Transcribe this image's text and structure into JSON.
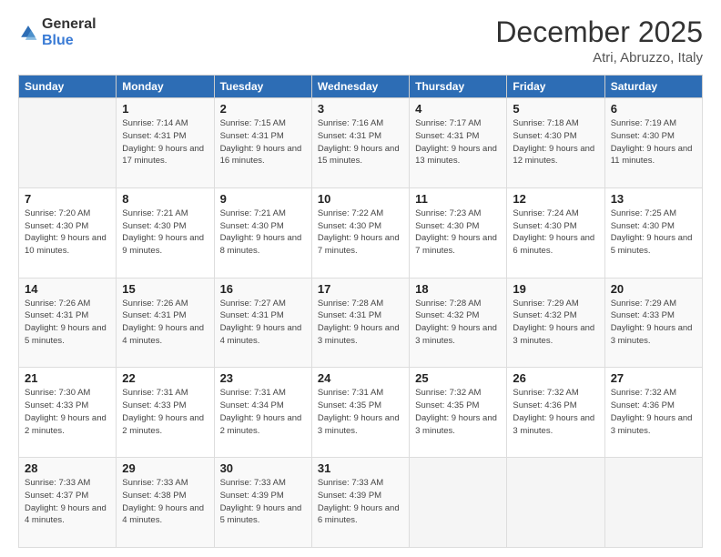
{
  "logo": {
    "general": "General",
    "blue": "Blue"
  },
  "header": {
    "month": "December 2025",
    "location": "Atri, Abruzzo, Italy"
  },
  "weekdays": [
    "Sunday",
    "Monday",
    "Tuesday",
    "Wednesday",
    "Thursday",
    "Friday",
    "Saturday"
  ],
  "weeks": [
    [
      {
        "day": "",
        "sunrise": "",
        "sunset": "",
        "daylight": ""
      },
      {
        "day": "1",
        "sunrise": "Sunrise: 7:14 AM",
        "sunset": "Sunset: 4:31 PM",
        "daylight": "Daylight: 9 hours and 17 minutes."
      },
      {
        "day": "2",
        "sunrise": "Sunrise: 7:15 AM",
        "sunset": "Sunset: 4:31 PM",
        "daylight": "Daylight: 9 hours and 16 minutes."
      },
      {
        "day": "3",
        "sunrise": "Sunrise: 7:16 AM",
        "sunset": "Sunset: 4:31 PM",
        "daylight": "Daylight: 9 hours and 15 minutes."
      },
      {
        "day": "4",
        "sunrise": "Sunrise: 7:17 AM",
        "sunset": "Sunset: 4:31 PM",
        "daylight": "Daylight: 9 hours and 13 minutes."
      },
      {
        "day": "5",
        "sunrise": "Sunrise: 7:18 AM",
        "sunset": "Sunset: 4:30 PM",
        "daylight": "Daylight: 9 hours and 12 minutes."
      },
      {
        "day": "6",
        "sunrise": "Sunrise: 7:19 AM",
        "sunset": "Sunset: 4:30 PM",
        "daylight": "Daylight: 9 hours and 11 minutes."
      }
    ],
    [
      {
        "day": "7",
        "sunrise": "Sunrise: 7:20 AM",
        "sunset": "Sunset: 4:30 PM",
        "daylight": "Daylight: 9 hours and 10 minutes."
      },
      {
        "day": "8",
        "sunrise": "Sunrise: 7:21 AM",
        "sunset": "Sunset: 4:30 PM",
        "daylight": "Daylight: 9 hours and 9 minutes."
      },
      {
        "day": "9",
        "sunrise": "Sunrise: 7:21 AM",
        "sunset": "Sunset: 4:30 PM",
        "daylight": "Daylight: 9 hours and 8 minutes."
      },
      {
        "day": "10",
        "sunrise": "Sunrise: 7:22 AM",
        "sunset": "Sunset: 4:30 PM",
        "daylight": "Daylight: 9 hours and 7 minutes."
      },
      {
        "day": "11",
        "sunrise": "Sunrise: 7:23 AM",
        "sunset": "Sunset: 4:30 PM",
        "daylight": "Daylight: 9 hours and 7 minutes."
      },
      {
        "day": "12",
        "sunrise": "Sunrise: 7:24 AM",
        "sunset": "Sunset: 4:30 PM",
        "daylight": "Daylight: 9 hours and 6 minutes."
      },
      {
        "day": "13",
        "sunrise": "Sunrise: 7:25 AM",
        "sunset": "Sunset: 4:30 PM",
        "daylight": "Daylight: 9 hours and 5 minutes."
      }
    ],
    [
      {
        "day": "14",
        "sunrise": "Sunrise: 7:26 AM",
        "sunset": "Sunset: 4:31 PM",
        "daylight": "Daylight: 9 hours and 5 minutes."
      },
      {
        "day": "15",
        "sunrise": "Sunrise: 7:26 AM",
        "sunset": "Sunset: 4:31 PM",
        "daylight": "Daylight: 9 hours and 4 minutes."
      },
      {
        "day": "16",
        "sunrise": "Sunrise: 7:27 AM",
        "sunset": "Sunset: 4:31 PM",
        "daylight": "Daylight: 9 hours and 4 minutes."
      },
      {
        "day": "17",
        "sunrise": "Sunrise: 7:28 AM",
        "sunset": "Sunset: 4:31 PM",
        "daylight": "Daylight: 9 hours and 3 minutes."
      },
      {
        "day": "18",
        "sunrise": "Sunrise: 7:28 AM",
        "sunset": "Sunset: 4:32 PM",
        "daylight": "Daylight: 9 hours and 3 minutes."
      },
      {
        "day": "19",
        "sunrise": "Sunrise: 7:29 AM",
        "sunset": "Sunset: 4:32 PM",
        "daylight": "Daylight: 9 hours and 3 minutes."
      },
      {
        "day": "20",
        "sunrise": "Sunrise: 7:29 AM",
        "sunset": "Sunset: 4:33 PM",
        "daylight": "Daylight: 9 hours and 3 minutes."
      }
    ],
    [
      {
        "day": "21",
        "sunrise": "Sunrise: 7:30 AM",
        "sunset": "Sunset: 4:33 PM",
        "daylight": "Daylight: 9 hours and 2 minutes."
      },
      {
        "day": "22",
        "sunrise": "Sunrise: 7:31 AM",
        "sunset": "Sunset: 4:33 PM",
        "daylight": "Daylight: 9 hours and 2 minutes."
      },
      {
        "day": "23",
        "sunrise": "Sunrise: 7:31 AM",
        "sunset": "Sunset: 4:34 PM",
        "daylight": "Daylight: 9 hours and 2 minutes."
      },
      {
        "day": "24",
        "sunrise": "Sunrise: 7:31 AM",
        "sunset": "Sunset: 4:35 PM",
        "daylight": "Daylight: 9 hours and 3 minutes."
      },
      {
        "day": "25",
        "sunrise": "Sunrise: 7:32 AM",
        "sunset": "Sunset: 4:35 PM",
        "daylight": "Daylight: 9 hours and 3 minutes."
      },
      {
        "day": "26",
        "sunrise": "Sunrise: 7:32 AM",
        "sunset": "Sunset: 4:36 PM",
        "daylight": "Daylight: 9 hours and 3 minutes."
      },
      {
        "day": "27",
        "sunrise": "Sunrise: 7:32 AM",
        "sunset": "Sunset: 4:36 PM",
        "daylight": "Daylight: 9 hours and 3 minutes."
      }
    ],
    [
      {
        "day": "28",
        "sunrise": "Sunrise: 7:33 AM",
        "sunset": "Sunset: 4:37 PM",
        "daylight": "Daylight: 9 hours and 4 minutes."
      },
      {
        "day": "29",
        "sunrise": "Sunrise: 7:33 AM",
        "sunset": "Sunset: 4:38 PM",
        "daylight": "Daylight: 9 hours and 4 minutes."
      },
      {
        "day": "30",
        "sunrise": "Sunrise: 7:33 AM",
        "sunset": "Sunset: 4:39 PM",
        "daylight": "Daylight: 9 hours and 5 minutes."
      },
      {
        "day": "31",
        "sunrise": "Sunrise: 7:33 AM",
        "sunset": "Sunset: 4:39 PM",
        "daylight": "Daylight: 9 hours and 6 minutes."
      },
      {
        "day": "",
        "sunrise": "",
        "sunset": "",
        "daylight": ""
      },
      {
        "day": "",
        "sunrise": "",
        "sunset": "",
        "daylight": ""
      },
      {
        "day": "",
        "sunrise": "",
        "sunset": "",
        "daylight": ""
      }
    ]
  ]
}
